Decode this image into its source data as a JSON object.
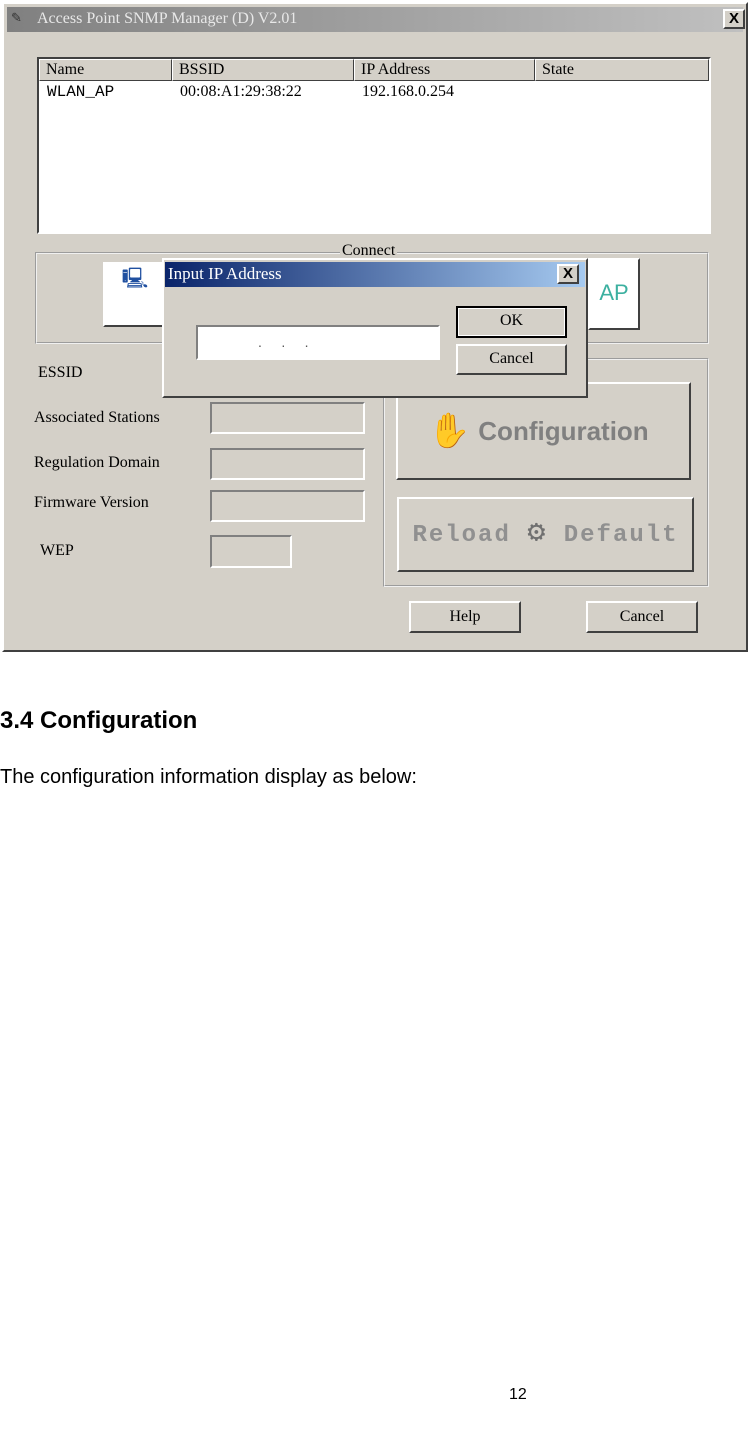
{
  "window": {
    "title": "Access Point SNMP Manager (D) V2.01",
    "close": "X",
    "list": {
      "columns": [
        "Name",
        "BSSID",
        "IP Address",
        "State"
      ],
      "rows": [
        [
          "WLAN_AP",
          "00:08:A1:29:38:22",
          "192.168.0.254",
          ""
        ]
      ]
    },
    "connect_group": "Connect",
    "ap_button": "AP",
    "fields": {
      "essid": "ESSID",
      "stations": "Associated Stations",
      "domain": "Regulation Domain",
      "firmware": "Firmware Version",
      "wep": "WEP"
    },
    "configuration_button": "Configuration",
    "reload_label": "Reload",
    "default_label": "Default",
    "help_button": "Help",
    "cancel_button": "Cancel"
  },
  "dialog": {
    "title": "Input IP Address",
    "close": "X",
    "ip_value": ".     .     .",
    "ok": "OK",
    "cancel": "Cancel"
  },
  "document": {
    "heading": "3.4 Configuration",
    "body": "The configuration information display as below:",
    "page_number": "12"
  }
}
